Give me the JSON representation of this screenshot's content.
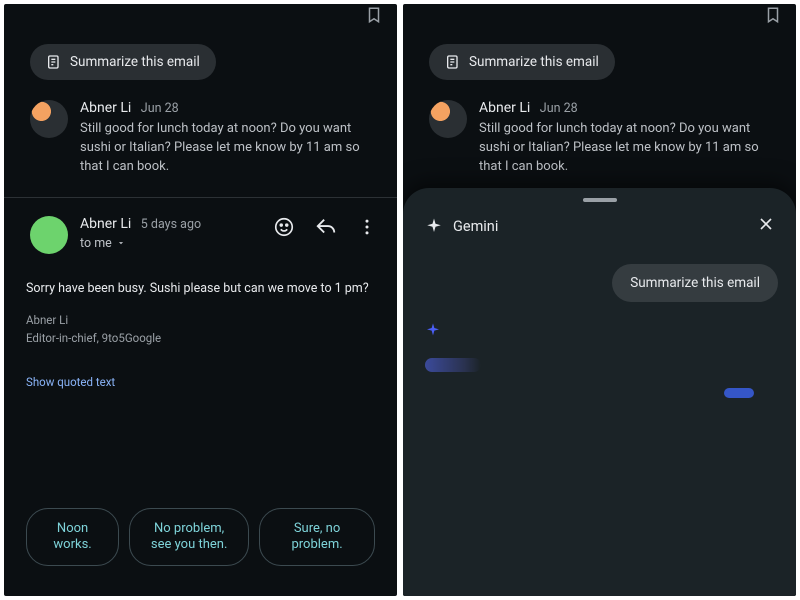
{
  "left": {
    "summarize_chip": "Summarize this email",
    "thread": {
      "sender": "Abner Li",
      "date": "Jun 28",
      "preview": "Still good for lunch today at noon? Do you want sushi or Italian? Please let me know by 11 am so that I can book."
    },
    "message": {
      "sender": "Abner Li",
      "age": "5 days ago",
      "recipient": "to me",
      "body": "Sorry have been busy. Sushi please but can we move to 1 pm?",
      "signature_name": "Abner Li",
      "signature_title": "Editor-in-chief, 9to5Google",
      "show_quoted": "Show quoted text"
    },
    "smart_replies": [
      "Noon works.",
      "No problem, see you then.",
      "Sure, no problem."
    ]
  },
  "right": {
    "summarize_chip": "Summarize this email",
    "thread": {
      "sender": "Abner Li",
      "date": "Jun 28",
      "preview": "Still good for lunch today at noon? Do you want sushi or Italian? Please let me know by 11 am so that I can book."
    },
    "sheet": {
      "title": "Gemini",
      "user_prompt": "Summarize this email"
    }
  }
}
